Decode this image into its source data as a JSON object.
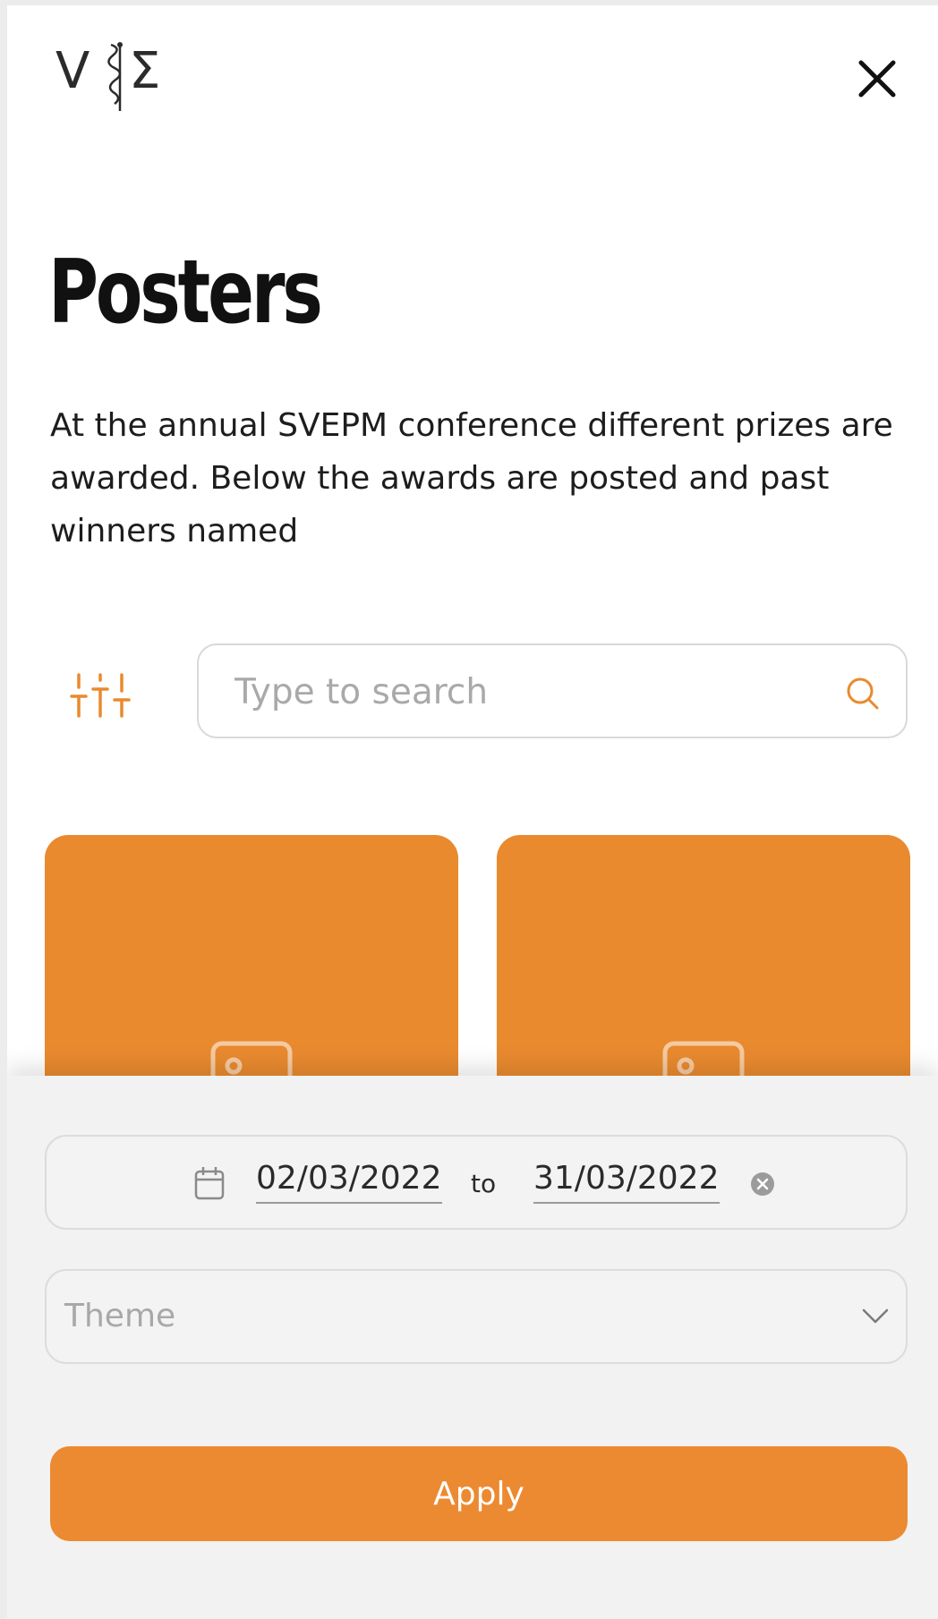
{
  "colors": {
    "accent": "#E98A2F",
    "sheet_background": "#F2F2F2",
    "text": "#1D1D1D",
    "placeholder": "#A9A9A9"
  },
  "header": {
    "logo_icon": "svepm-logo-icon",
    "close_icon": "close-icon"
  },
  "page": {
    "title": "Posters",
    "intro": "At the annual SVEPM conference different prizes are awarded. Below the awards are posted and past winners named"
  },
  "search": {
    "filter_icon": "sliders-icon",
    "placeholder": "Type to search",
    "value": "",
    "search_icon": "search-icon"
  },
  "cards": [
    {
      "image_icon": "image-placeholder-icon"
    },
    {
      "image_icon": "image-placeholder-icon"
    }
  ],
  "filters": {
    "date_icon": "calendar-icon",
    "date_from": "02/03/2022",
    "to_label": "to",
    "date_to": "31/03/2022",
    "clear_icon": "clear-circle-icon",
    "theme_placeholder": "Theme",
    "theme_icon": "chevron-down-icon",
    "apply_label": "Apply"
  }
}
